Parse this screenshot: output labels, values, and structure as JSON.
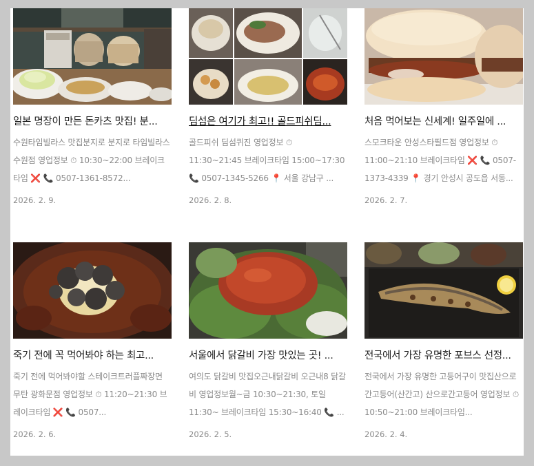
{
  "posts": [
    {
      "title": "일본 명장이 만든 돈카츠 맛집! 분...",
      "desc": "수원타임빌라스 맛집분지로 분지로 타임빌라스 수원점 영업정보 ⏱ 10:30~22:00 브레이크타임 ❌ 📞 0507-1361-8572...",
      "date": "2026. 2. 9."
    },
    {
      "title": "딤섬은 여기가 최고!! 골드피쉬딤...",
      "desc": "골드피쉬 딤섬퀴진 영업정보 ⏱ 11:30~21:45 브레이크타임 15:00~17:30 📞 0507-1345-5266 📍 서울 강남구 ...",
      "date": "2026. 2. 8."
    },
    {
      "title": "처음 먹어보는 신세계! 일주일에 ...",
      "desc": "스모크타운 안성스타필드점 영업정보 ⏱ 11:00~21:10 브레이크타임 ❌ 📞 0507-1373-4339 📍 경기 안성시 공도읍 서동...",
      "date": "2026. 2. 7."
    },
    {
      "title": "죽기 전에 꼭 먹어봐야 하는 최고...",
      "desc": "죽기 전에 먹어봐야할 스테이크트러플짜장면 무탄 광화문점 영업정보 ⏱ 11:20~21:30 브레이크타임 ❌ 📞 0507...",
      "date": "2026. 2. 6."
    },
    {
      "title": "서울에서 닭갈비 가장 맛있는 곳! ...",
      "desc": "여의도 닭갈비 맛집오근내닭갈비 오근내8 닭갈비 영업정보월~금 10:30~21:30, 토일 11:30~ 브레이크타임 15:30~16:40 📞 ...",
      "date": "2026. 2. 5."
    },
    {
      "title": "전국에서 가장 유명한 포브스 선정...",
      "desc": "전국에서 가장 유명한 고등어구이 맛집산으로간고등어(산간고) 산으로간고등어 영업정보 ⏱ 10:50~21:00 브레이크타임...",
      "date": "2026. 2. 4."
    }
  ]
}
